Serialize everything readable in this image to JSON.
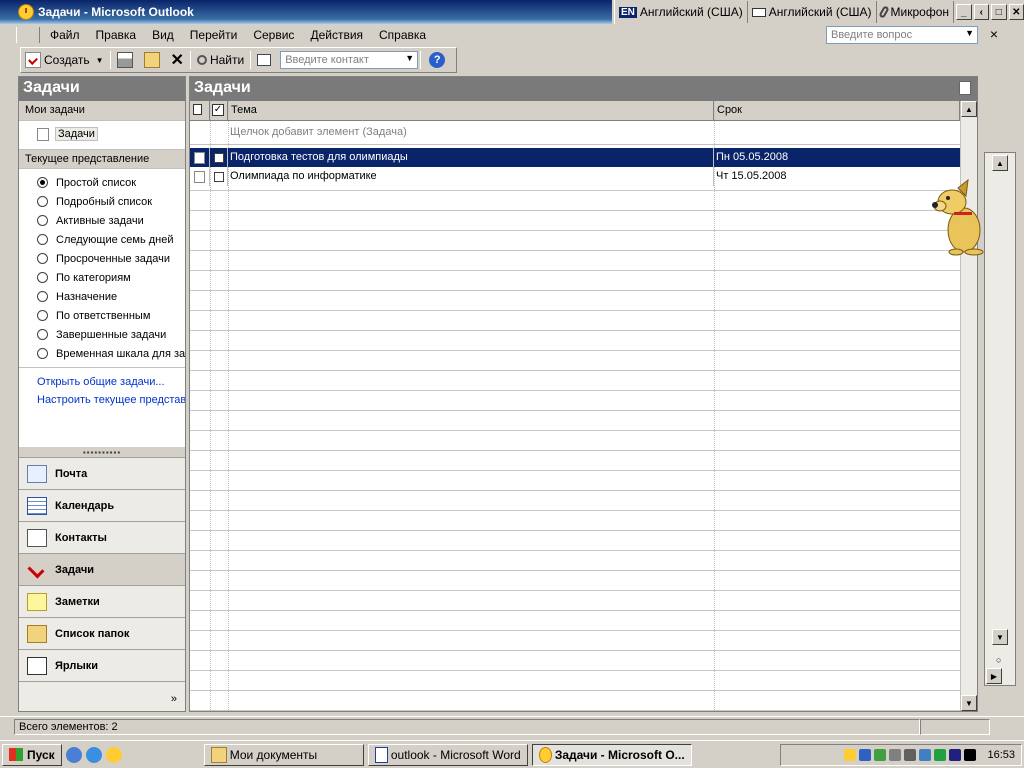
{
  "window": {
    "title": "Задачи - Microsoft Outlook"
  },
  "langbar": {
    "lang_code": "EN",
    "lang1": "Английский (США)",
    "lang2": "Английский (США)",
    "mic": "Микрофон"
  },
  "menu": [
    "Файл",
    "Правка",
    "Вид",
    "Перейти",
    "Сервис",
    "Действия",
    "Справка"
  ],
  "ask_placeholder": "Введите вопрос",
  "toolbar": {
    "create_label": "Создать",
    "find_label": "Найти",
    "contact_placeholder": "Введите контакт"
  },
  "nav": {
    "title": "Задачи",
    "my_tasks_header": "Мои задачи",
    "my_tasks_item": "Задачи",
    "current_view_header": "Текущее представление",
    "views": [
      {
        "label": "Простой список",
        "selected": true
      },
      {
        "label": "Подробный список",
        "selected": false
      },
      {
        "label": "Активные задачи",
        "selected": false
      },
      {
        "label": "Следующие семь дней",
        "selected": false
      },
      {
        "label": "Просроченные задачи",
        "selected": false
      },
      {
        "label": "По категориям",
        "selected": false
      },
      {
        "label": "Назначение",
        "selected": false
      },
      {
        "label": "По ответственным",
        "selected": false
      },
      {
        "label": "Завершенные задачи",
        "selected": false
      },
      {
        "label": "Временная шкала для задач",
        "selected": false
      }
    ],
    "link_open": "Открыть общие задачи...",
    "link_customize": "Настроить текущее представление...",
    "buttons": [
      {
        "label": "Почта",
        "icon": "mail-icon",
        "selected": false
      },
      {
        "label": "Календарь",
        "icon": "calendar-icon",
        "selected": false
      },
      {
        "label": "Контакты",
        "icon": "contacts-icon",
        "selected": false
      },
      {
        "label": "Задачи",
        "icon": "tasks-icon",
        "selected": true
      },
      {
        "label": "Заметки",
        "icon": "notes-icon",
        "selected": false
      },
      {
        "label": "Список папок",
        "icon": "folder-list-icon",
        "selected": false
      },
      {
        "label": "Ярлыки",
        "icon": "shortcuts-icon",
        "selected": false
      }
    ]
  },
  "main": {
    "title": "Задачи",
    "columns": {
      "subject": "Тема",
      "due": "Срок"
    },
    "add_hint": "Щелчок добавит элемент (Задача)",
    "tasks": [
      {
        "subject": "Подготовка тестов для олимпиады",
        "due": "Пн 05.05.2008",
        "selected": true
      },
      {
        "subject": "Олимпиада по информатике",
        "due": "Чт 15.05.2008",
        "selected": false
      }
    ]
  },
  "status": {
    "count": "Всего элементов: 2"
  },
  "taskbar": {
    "start": "Пуск",
    "tasks": [
      {
        "label": "Мои документы",
        "active": false
      },
      {
        "label": "outlook - Microsoft Word",
        "active": false
      },
      {
        "label": "Задачи - Microsoft O...",
        "active": true
      }
    ],
    "clock": "16:53"
  }
}
